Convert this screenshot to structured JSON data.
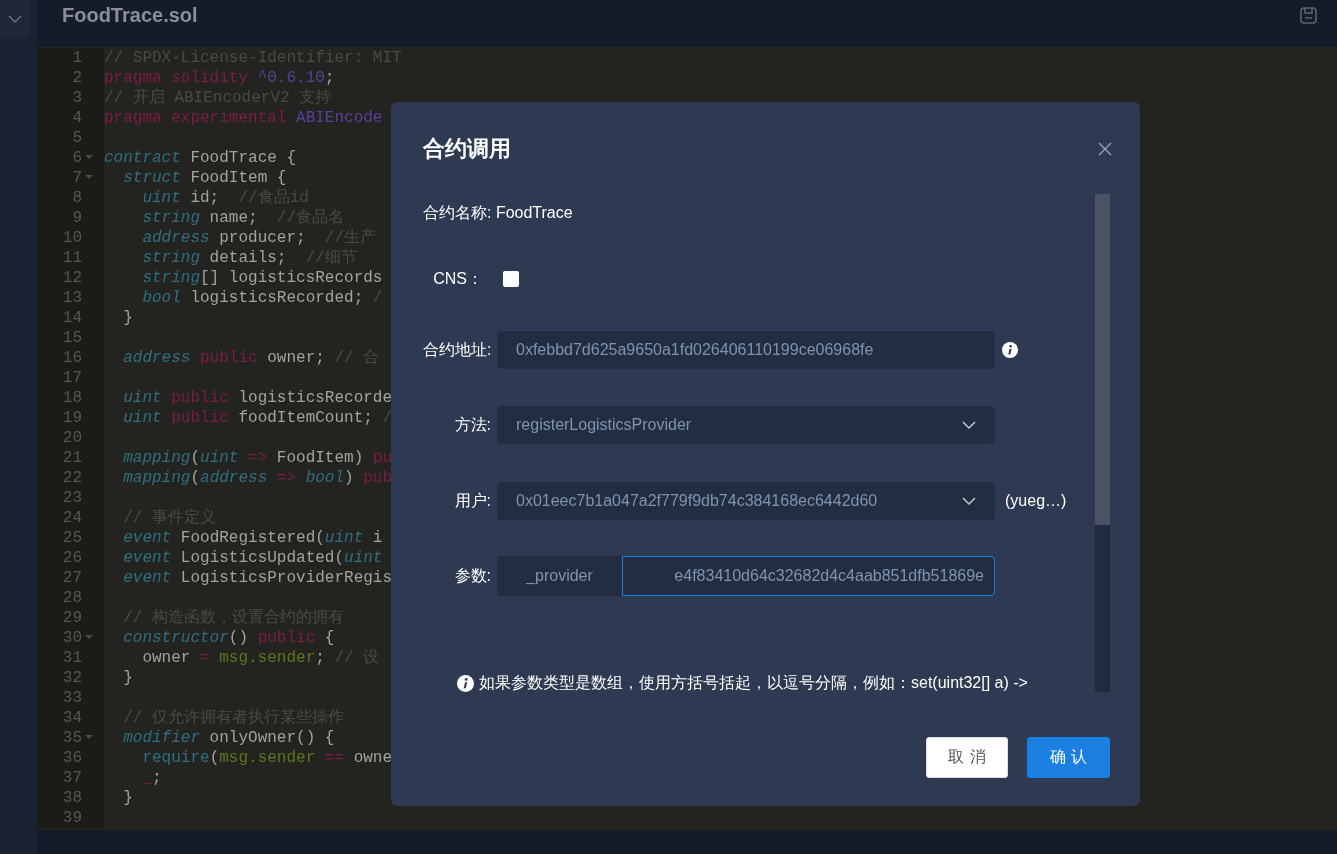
{
  "header": {
    "file_title": "FoodTrace.sol"
  },
  "editor": {
    "lines": [
      {
        "n": "1",
        "fold": false,
        "tokens": [
          {
            "text": "// SPDX-License-Identifier: MIT",
            "kind": "comment"
          }
        ]
      },
      {
        "n": "2",
        "fold": false,
        "tokens": [
          {
            "text": "pragma solidity ",
            "kind": "keyword"
          },
          {
            "text": "^0.6.10",
            "kind": "number"
          },
          {
            "text": ";",
            "kind": "plain"
          }
        ]
      },
      {
        "n": "3",
        "fold": false,
        "tokens": [
          {
            "text": "// 开启 ABIEncoderV2 支持",
            "kind": "comment"
          }
        ]
      },
      {
        "n": "4",
        "fold": false,
        "tokens": [
          {
            "text": "pragma experimental ",
            "kind": "keyword"
          },
          {
            "text": "ABIEncode",
            "kind": "number"
          }
        ]
      },
      {
        "n": "5",
        "fold": false
      },
      {
        "n": "6",
        "fold": true,
        "tokens": [
          {
            "text": "contract",
            "kind": "type"
          },
          {
            "text": " FoodTrace {",
            "kind": "plain"
          }
        ]
      },
      {
        "n": "7",
        "fold": true,
        "tokens": [
          {
            "text": "  struct",
            "kind": "type"
          },
          {
            "text": " FoodItem {",
            "kind": "plain"
          }
        ]
      },
      {
        "n": "8",
        "fold": false,
        "tokens": [
          {
            "text": "    uint",
            "kind": "type"
          },
          {
            "text": " id;  ",
            "kind": "plain"
          },
          {
            "text": "//食品id",
            "kind": "comment"
          }
        ]
      },
      {
        "n": "9",
        "fold": false,
        "tokens": [
          {
            "text": "    string",
            "kind": "type"
          },
          {
            "text": " name;  ",
            "kind": "plain"
          },
          {
            "text": "//食品名",
            "kind": "comment"
          }
        ]
      },
      {
        "n": "10",
        "fold": false,
        "tokens": [
          {
            "text": "    address",
            "kind": "type"
          },
          {
            "text": " producer;  ",
            "kind": "plain"
          },
          {
            "text": "//生产",
            "kind": "comment"
          }
        ]
      },
      {
        "n": "11",
        "fold": false,
        "tokens": [
          {
            "text": "    string",
            "kind": "type"
          },
          {
            "text": " details;  ",
            "kind": "plain"
          },
          {
            "text": "//细节",
            "kind": "comment"
          }
        ]
      },
      {
        "n": "12",
        "fold": false,
        "tokens": [
          {
            "text": "    string",
            "kind": "type"
          },
          {
            "text": "[] logisticsRecords",
            "kind": "plain"
          }
        ]
      },
      {
        "n": "13",
        "fold": false,
        "tokens": [
          {
            "text": "    bool",
            "kind": "type"
          },
          {
            "text": " logisticsRecorded; ",
            "kind": "plain"
          },
          {
            "text": "/",
            "kind": "comment"
          }
        ]
      },
      {
        "n": "14",
        "fold": false,
        "tokens": [
          {
            "text": "  }",
            "kind": "plain"
          }
        ]
      },
      {
        "n": "15",
        "fold": false
      },
      {
        "n": "16",
        "fold": false,
        "tokens": [
          {
            "text": "  address ",
            "kind": "type"
          },
          {
            "text": "public",
            "kind": "keyword"
          },
          {
            "text": " owner; ",
            "kind": "plain"
          },
          {
            "text": "// 合",
            "kind": "comment"
          }
        ]
      },
      {
        "n": "17",
        "fold": false
      },
      {
        "n": "18",
        "fold": false,
        "tokens": [
          {
            "text": "  uint ",
            "kind": "type"
          },
          {
            "text": "public",
            "kind": "keyword"
          },
          {
            "text": " logisticsRecorde",
            "kind": "plain"
          }
        ]
      },
      {
        "n": "19",
        "fold": false,
        "tokens": [
          {
            "text": "  uint ",
            "kind": "type"
          },
          {
            "text": "public",
            "kind": "keyword"
          },
          {
            "text": " foodItemCount; ",
            "kind": "plain"
          },
          {
            "text": "/",
            "kind": "comment"
          }
        ]
      },
      {
        "n": "20",
        "fold": false
      },
      {
        "n": "21",
        "fold": false,
        "tokens": [
          {
            "text": "  mapping",
            "kind": "type"
          },
          {
            "text": "(",
            "kind": "plain"
          },
          {
            "text": "uint ",
            "kind": "type"
          },
          {
            "text": "=>",
            "kind": "keyword"
          },
          {
            "text": " FoodItem) ",
            "kind": "plain"
          },
          {
            "text": "pu",
            "kind": "keyword"
          }
        ]
      },
      {
        "n": "22",
        "fold": false,
        "tokens": [
          {
            "text": "  mapping",
            "kind": "type"
          },
          {
            "text": "(",
            "kind": "plain"
          },
          {
            "text": "address ",
            "kind": "type"
          },
          {
            "text": "=> ",
            "kind": "keyword"
          },
          {
            "text": "bool",
            "kind": "type"
          },
          {
            "text": ") ",
            "kind": "plain"
          },
          {
            "text": "pub",
            "kind": "keyword"
          }
        ]
      },
      {
        "n": "23",
        "fold": false
      },
      {
        "n": "24",
        "fold": false,
        "tokens": [
          {
            "text": "  // 事件定义",
            "kind": "comment"
          }
        ]
      },
      {
        "n": "25",
        "fold": false,
        "tokens": [
          {
            "text": "  event",
            "kind": "type"
          },
          {
            "text": " FoodRegistered(",
            "kind": "plain"
          },
          {
            "text": "uint",
            "kind": "type"
          },
          {
            "text": " i",
            "kind": "plain"
          }
        ]
      },
      {
        "n": "26",
        "fold": false,
        "tokens": [
          {
            "text": "  event",
            "kind": "type"
          },
          {
            "text": " LogisticsUpdated(",
            "kind": "plain"
          },
          {
            "text": "uint",
            "kind": "type"
          }
        ]
      },
      {
        "n": "27",
        "fold": false,
        "tokens": [
          {
            "text": "  event",
            "kind": "type"
          },
          {
            "text": " LogisticsProviderRegis",
            "kind": "plain"
          }
        ]
      },
      {
        "n": "28",
        "fold": false
      },
      {
        "n": "29",
        "fold": false,
        "tokens": [
          {
            "text": "  // 构造函数，设置合约的拥有",
            "kind": "comment"
          }
        ]
      },
      {
        "n": "30",
        "fold": true,
        "tokens": [
          {
            "text": "  constructor",
            "kind": "type"
          },
          {
            "text": "() ",
            "kind": "plain"
          },
          {
            "text": "public",
            "kind": "keyword"
          },
          {
            "text": " {",
            "kind": "plain"
          }
        ]
      },
      {
        "n": "31",
        "fold": false,
        "tokens": [
          {
            "text": "    owner ",
            "kind": "plain"
          },
          {
            "text": "= ",
            "kind": "keyword"
          },
          {
            "text": "msg.sender",
            "kind": "global"
          },
          {
            "text": "; ",
            "kind": "plain"
          },
          {
            "text": "// 设",
            "kind": "comment"
          }
        ]
      },
      {
        "n": "32",
        "fold": false,
        "tokens": [
          {
            "text": "  }",
            "kind": "plain"
          }
        ]
      },
      {
        "n": "33",
        "fold": false
      },
      {
        "n": "34",
        "fold": false,
        "tokens": [
          {
            "text": "  // 仅允许拥有者执行某些操作",
            "kind": "comment"
          }
        ]
      },
      {
        "n": "35",
        "fold": true,
        "tokens": [
          {
            "text": "  modifier",
            "kind": "type"
          },
          {
            "text": " onlyOwner() {",
            "kind": "plain"
          }
        ]
      },
      {
        "n": "36",
        "fold": false,
        "tokens": [
          {
            "text": "    require",
            "kind": "function"
          },
          {
            "text": "(",
            "kind": "plain"
          },
          {
            "text": "msg.sender ",
            "kind": "global"
          },
          {
            "text": "==",
            "kind": "keyword"
          },
          {
            "text": " owne",
            "kind": "plain"
          }
        ]
      },
      {
        "n": "37",
        "fold": false,
        "tokens": [
          {
            "text": "    _",
            "kind": "keyword"
          },
          {
            "text": ";",
            "kind": "plain"
          }
        ]
      },
      {
        "n": "38",
        "fold": false,
        "tokens": [
          {
            "text": "  }",
            "kind": "plain"
          }
        ]
      },
      {
        "n": "39",
        "fold": false
      }
    ]
  },
  "dialog": {
    "title": "合约调用",
    "contract_name": "合约名称: FoodTrace",
    "cns": {
      "label": "CNS：",
      "checked": false
    },
    "address": {
      "label": "合约地址:",
      "value": "0xfebbd7d625a9650a1fd026406110199ce06968fe"
    },
    "method": {
      "label": "方法:",
      "value": "registerLogisticsProvider"
    },
    "user": {
      "label": "用户:",
      "value": "0x01eec7b1a047a2f779f9db74c384168ec6442d60",
      "note": "(yueg…)"
    },
    "params": {
      "label": "参数:",
      "name": "_provider",
      "value": "e4f83410d64c32682d4c4aab851dfb51869e"
    },
    "hint": "如果参数类型是数组，使用方括号括起，以逗号分隔，例如：set(uint32[] a) ->",
    "buttons": [
      {
        "label": "取 消",
        "kind": "secondary"
      },
      {
        "label": "确 认",
        "kind": "primary"
      }
    ]
  }
}
